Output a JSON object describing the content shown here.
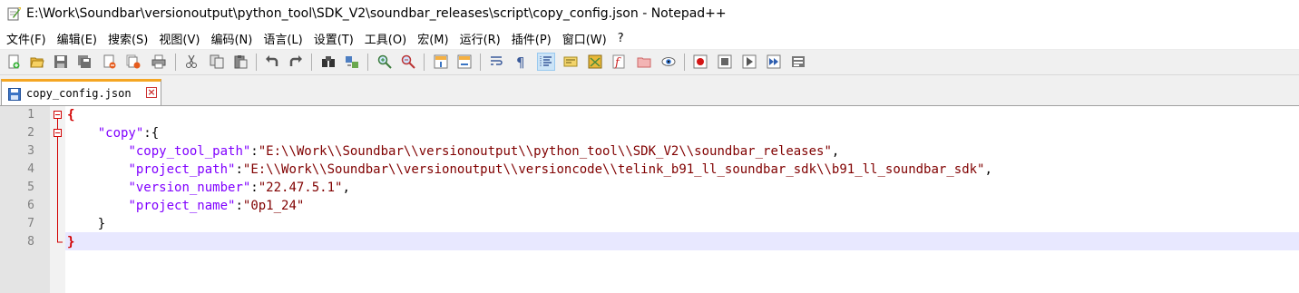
{
  "window": {
    "title": "E:\\Work\\Soundbar\\versionoutput\\python_tool\\SDK_V2\\soundbar_releases\\script\\copy_config.json - Notepad++"
  },
  "menu": [
    "文件(F)",
    "编辑(E)",
    "搜索(S)",
    "视图(V)",
    "编码(N)",
    "语言(L)",
    "设置(T)",
    "工具(O)",
    "宏(M)",
    "运行(R)",
    "插件(P)",
    "窗口(W)",
    "?"
  ],
  "toolbar_icons": [
    "new-file-icon",
    "open-file-icon",
    "save-icon",
    "save-all-icon",
    "close-icon",
    "close-all-icon",
    "print-icon",
    "cut-icon",
    "copy-icon",
    "paste-icon",
    "undo-icon",
    "redo-icon",
    "find-icon",
    "replace-icon",
    "zoom-in-icon",
    "zoom-out-icon",
    "sync-vertical-icon",
    "sync-horizontal-icon",
    "word-wrap-icon",
    "show-all-chars-icon",
    "indent-guide-icon",
    "udl-icon",
    "doc-map-icon",
    "function-list-icon",
    "folder-workspace-icon",
    "monitoring-icon",
    "record-macro-icon",
    "stop-record-icon",
    "play-macro-icon",
    "run-macro-multiple-icon",
    "save-macro-icon"
  ],
  "tab": {
    "label": "copy_config.json"
  },
  "editor": {
    "line_numbers": [
      "1",
      "2",
      "3",
      "4",
      "5",
      "6",
      "7",
      "8"
    ],
    "lines": {
      "l1_brace": "{",
      "l2_key": "\"copy\"",
      "l2_rest": ":{",
      "l3_key": "\"copy_tool_path\"",
      "l3_colon": ":",
      "l3_val": "\"E:\\\\Work\\\\Soundbar\\\\versionoutput\\\\python_tool\\\\SDK_V2\\\\soundbar_releases\"",
      "l3_comma": ",",
      "l4_key": "\"project_path\"",
      "l4_colon": ":",
      "l4_val": "\"E:\\\\Work\\\\Soundbar\\\\versionoutput\\\\versioncode\\\\telink_b91_ll_soundbar_sdk\\\\b91_ll_soundbar_sdk\"",
      "l4_comma": ",",
      "l5_key": "\"version_number\"",
      "l5_colon": ":",
      "l5_val": "\"22.47.5.1\"",
      "l5_comma": ",",
      "l6_key": "\"project_name\"",
      "l6_colon": ":",
      "l6_val": "\"0p1_24\"",
      "l7_brace": "}",
      "l8_brace": "}"
    }
  },
  "colors": {
    "key": "#8000ff",
    "string": "#800000",
    "brace_highlight": "#d20000",
    "current_line": "#e8e8ff",
    "active_tab_accent": "#f5a623"
  }
}
